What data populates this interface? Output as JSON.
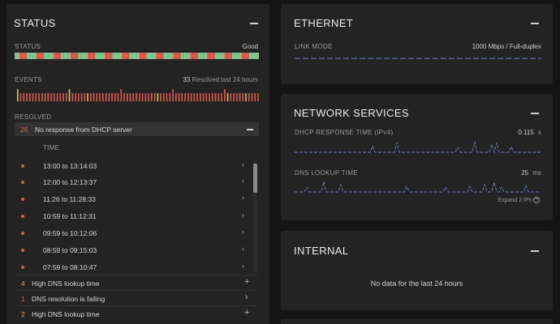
{
  "status_panel": {
    "title": "STATUS",
    "status_label": "STATUS",
    "status_value": "Good",
    "events_label": "EVENTS",
    "events_count": "33",
    "events_note": "Resolved last 24 hours",
    "resolved_label": "RESOLVED",
    "expanded_group": {
      "count": "26",
      "label": "No response from DHCP server"
    },
    "time_header": "TIME",
    "times": [
      "13:00 to 13:14:03",
      "12:00 to 12:13:37",
      "11:26 to 11:28:33",
      "10:59 to 11:12:31",
      "09:59 to 10:12:06",
      "08:59 to 09:15:03",
      "07:59 to 08:10:47"
    ],
    "other_groups": [
      {
        "count": "4",
        "label": "High DNS lookup time",
        "action": "+"
      },
      {
        "count": "1",
        "label": "DNS resolution is failing",
        "action": "›"
      },
      {
        "count": "2",
        "label": "High DNS lookup time",
        "action": "+"
      }
    ]
  },
  "ethernet_panel": {
    "title": "ETHERNET",
    "link_mode_label": "LINK MODE",
    "link_mode_value": "1000 Mbps / Full-duplex"
  },
  "network_services_panel": {
    "title": "NETWORK SERVICES",
    "dhcp_label": "DHCP RESPONSE TIME (IPv4)",
    "dhcp_value": "0.115",
    "dhcp_unit": "s",
    "dns_label": "DNS LOOKUP TIME",
    "dns_value": "25",
    "dns_unit": "ms",
    "expand_label": "Expand 2 IPs"
  },
  "internal_panel": {
    "title": "INTERNAL",
    "empty_message": "No data for the last 24 hours"
  },
  "colors": {
    "good": "#7fc98a",
    "bad": "#e05a4e",
    "warn": "#d9c85a",
    "line": "#6f82c9"
  }
}
